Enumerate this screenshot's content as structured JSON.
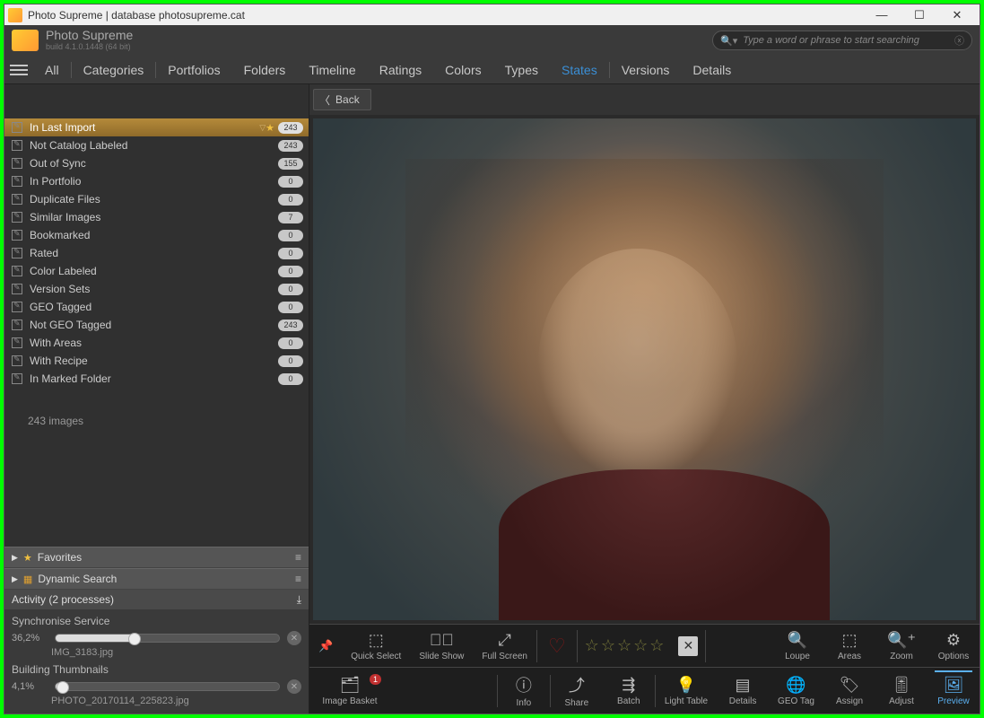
{
  "window": {
    "title": "Photo Supreme | database photosupreme.cat"
  },
  "app": {
    "name": "Photo Supreme",
    "build": "build 4.1.0.1448 (64 bit)"
  },
  "search": {
    "placeholder": "Type a word or phrase to start searching"
  },
  "nav": {
    "items": [
      "All",
      "Categories",
      "Portfolios",
      "Folders",
      "Timeline",
      "Ratings",
      "Colors",
      "Types",
      "States",
      "Versions",
      "Details"
    ],
    "active": "States"
  },
  "back_label": "Back",
  "states": [
    {
      "label": "In Last Import",
      "count": "243",
      "selected": true,
      "star": true
    },
    {
      "label": "Not Catalog Labeled",
      "count": "243"
    },
    {
      "label": "Out of Sync",
      "count": "155"
    },
    {
      "label": "In Portfolio",
      "count": "0"
    },
    {
      "label": "Duplicate Files",
      "count": "0"
    },
    {
      "label": "Similar Images",
      "count": "7"
    },
    {
      "label": "Bookmarked",
      "count": "0"
    },
    {
      "label": "Rated",
      "count": "0"
    },
    {
      "label": "Color Labeled",
      "count": "0"
    },
    {
      "label": "Version Sets",
      "count": "0"
    },
    {
      "label": "GEO Tagged",
      "count": "0"
    },
    {
      "label": "Not GEO Tagged",
      "count": "243"
    },
    {
      "label": "With Areas",
      "count": "0"
    },
    {
      "label": "With Recipe",
      "count": "0"
    },
    {
      "label": "In Marked Folder",
      "count": "0"
    }
  ],
  "image_count": "243 images",
  "panels": {
    "favorites": "Favorites",
    "dynamic": "Dynamic Search"
  },
  "activity": {
    "header": "Activity (2 processes)",
    "proc1": {
      "name": "Synchronise Service",
      "pct": "36,2%",
      "file": "IMG_3183.jpg",
      "fill": 36.2
    },
    "proc2": {
      "name": "Building Thumbnails",
      "pct": "4,1%",
      "file": "PHOTO_20170114_225823.jpg",
      "fill": 4.1
    }
  },
  "tools_upper": {
    "quick_select": "Quick Select",
    "slide_show": "Slide Show",
    "full_screen": "Full Screen",
    "loupe": "Loupe",
    "areas": "Areas",
    "zoom": "Zoom",
    "options": "Options"
  },
  "tools_lower": {
    "image_basket": "Image Basket",
    "info": "Info",
    "share": "Share",
    "batch": "Batch",
    "light_table": "Light Table",
    "details": "Details",
    "geo": "GEO Tag",
    "assign": "Assign",
    "adjust": "Adjust",
    "preview": "Preview"
  }
}
